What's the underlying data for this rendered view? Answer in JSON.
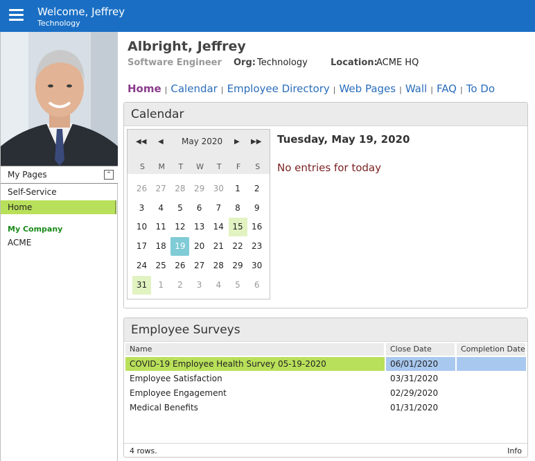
{
  "header": {
    "welcome": "Welcome, Jeffrey",
    "department": "Technology"
  },
  "sidebar": {
    "section_title": "My Pages",
    "collapse_glyph": "⌃",
    "items": [
      {
        "label": "Self-Service"
      },
      {
        "label": "Home",
        "selected": true
      }
    ],
    "company_heading": "My Company",
    "company_item": "ACME"
  },
  "employee": {
    "name": "Albright, Jeffrey",
    "title": "Software Engineer",
    "org_label": "Org:",
    "org": "Technology",
    "location_label": "Location:",
    "location": "ACME HQ"
  },
  "nav": {
    "items": [
      "Home",
      "Calendar",
      "Employee Directory",
      "Web Pages",
      "Wall",
      "FAQ",
      "To Do"
    ],
    "separator": "|",
    "active": "Home"
  },
  "calendar": {
    "panel_title": "Calendar",
    "month_label": "May 2020",
    "nav_glyphs": {
      "prev_year": "◀◀",
      "prev_month": "◀",
      "next_month": "▶",
      "next_year": "▶▶"
    },
    "dow": [
      "S",
      "M",
      "T",
      "W",
      "T",
      "F",
      "S"
    ],
    "weeks": [
      [
        {
          "d": "26",
          "o": true
        },
        {
          "d": "27",
          "o": true
        },
        {
          "d": "28",
          "o": true
        },
        {
          "d": "29",
          "o": true
        },
        {
          "d": "30",
          "o": true
        },
        {
          "d": "1"
        },
        {
          "d": "2"
        }
      ],
      [
        {
          "d": "3"
        },
        {
          "d": "4"
        },
        {
          "d": "5"
        },
        {
          "d": "6"
        },
        {
          "d": "7"
        },
        {
          "d": "8"
        },
        {
          "d": "9"
        }
      ],
      [
        {
          "d": "10"
        },
        {
          "d": "11"
        },
        {
          "d": "12"
        },
        {
          "d": "13"
        },
        {
          "d": "14"
        },
        {
          "d": "15",
          "h": true
        },
        {
          "d": "16"
        }
      ],
      [
        {
          "d": "17"
        },
        {
          "d": "18"
        },
        {
          "d": "19",
          "s": true
        },
        {
          "d": "20"
        },
        {
          "d": "21"
        },
        {
          "d": "22"
        },
        {
          "d": "23"
        }
      ],
      [
        {
          "d": "24"
        },
        {
          "d": "25"
        },
        {
          "d": "26"
        },
        {
          "d": "27"
        },
        {
          "d": "28"
        },
        {
          "d": "29"
        },
        {
          "d": "30"
        }
      ],
      [
        {
          "d": "31",
          "h": true
        },
        {
          "d": "1",
          "o": true
        },
        {
          "d": "2",
          "o": true
        },
        {
          "d": "3",
          "o": true
        },
        {
          "d": "4",
          "o": true
        },
        {
          "d": "5",
          "o": true
        },
        {
          "d": "6",
          "o": true
        }
      ]
    ],
    "selected_date_text": "Tuesday, May 19, 2020",
    "empty_text": "No entries for today"
  },
  "surveys": {
    "panel_title": "Employee Surveys",
    "columns": [
      "Name",
      "Close Date",
      "Completion Date"
    ],
    "rows": [
      {
        "name": "COVID-19 Employee Health Survey 05-19-2020",
        "close": "06/01/2020",
        "completion": "",
        "selected": true
      },
      {
        "name": "Employee Satisfaction",
        "close": "03/31/2020",
        "completion": ""
      },
      {
        "name": "Employee Engagement",
        "close": "02/29/2020",
        "completion": ""
      },
      {
        "name": "Medical Benefits",
        "close": "01/31/2020",
        "completion": ""
      }
    ],
    "row_count_text": "4 rows.",
    "info_link": "Info"
  },
  "colors": {
    "header_blue": "#1a6fc4",
    "selected_green": "#b9e05a",
    "selected_blue": "#a9c8ef",
    "today_teal": "#7fcbd6"
  }
}
